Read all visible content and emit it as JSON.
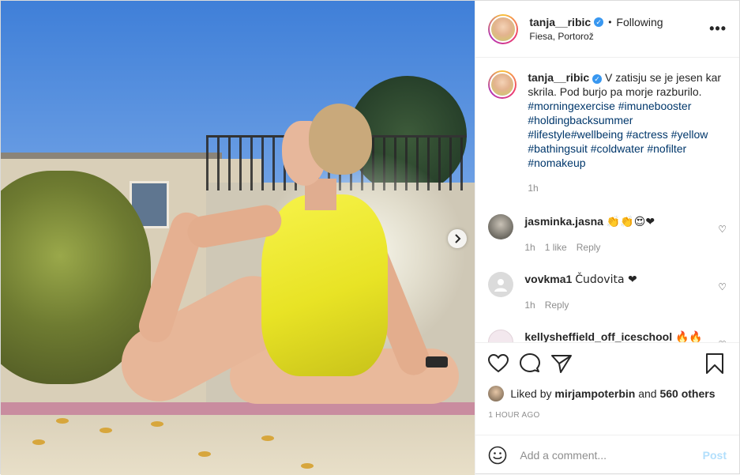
{
  "header": {
    "username": "tanja__ribic",
    "separator": "•",
    "follow_status": "Following",
    "location": "Fiesa, Portorož",
    "more_icon": "more-options-icon"
  },
  "caption": {
    "username": "tanja__ribic",
    "text": "V zatisju se je jesen kar skrila. Pod burjo pa morje razburilo.",
    "hashtags": "#morningexercise #imunebooster #holdingbacksummer #lifestyle#wellbeing #actress #yellow #bathingsuit #coldwater #nofilter #nomakeup",
    "time": "1h"
  },
  "comments": [
    {
      "username": "jasminka.jasna",
      "text": "👏👏😍❤",
      "time": "1h",
      "likes": "1 like",
      "reply": "Reply"
    },
    {
      "username": "vovkma1",
      "text": "Čudovita ❤",
      "time": "1h",
      "reply": "Reply"
    },
    {
      "username": "kellysheffield_off_iceschool",
      "text": "🔥🔥"
    }
  ],
  "likes": {
    "prefix": "Liked by",
    "user": "mirjampoterbin",
    "middle": "and",
    "others": "560 others"
  },
  "timestamp": "1 HOUR AGO",
  "add_comment": {
    "placeholder": "Add a comment...",
    "post_label": "Post"
  },
  "colors": {
    "link": "#00376b",
    "verified": "#3897f0",
    "post_button": "#b2dffc",
    "swimsuit": "#f0ec33"
  }
}
